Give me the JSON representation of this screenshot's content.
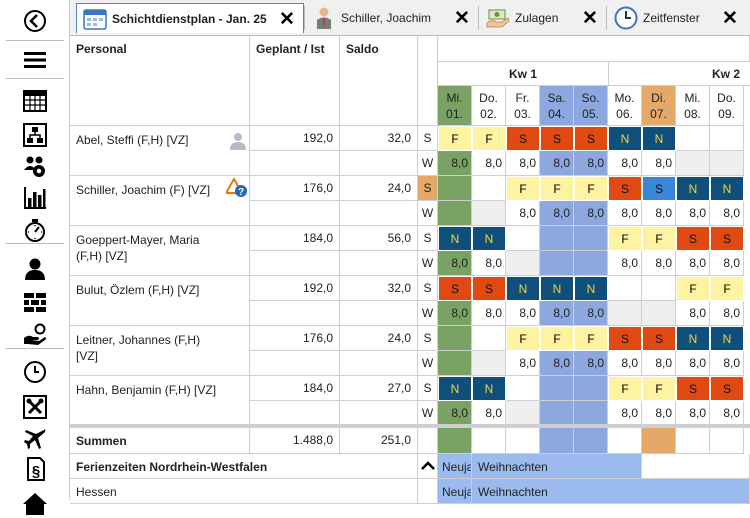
{
  "sidebar": {
    "items": [
      "back-icon",
      "menu-icon",
      "calendar-grid-icon",
      "org-chart-icon",
      "group-view-icon",
      "statistics-icon",
      "stopwatch-icon",
      "person-icon",
      "bricks-icon",
      "hand-coins-icon",
      "clock-icon",
      "tools-icon",
      "airplane-icon",
      "paragraph-icon",
      "home-icon"
    ]
  },
  "tabs": [
    {
      "label": "Schichtdienstplan - Jan. 25",
      "icon": "calendar-icon",
      "active": true
    },
    {
      "label": "Schiller, Joachim",
      "icon": "person-icon",
      "active": false
    },
    {
      "label": "Zulagen",
      "icon": "money-hand-icon",
      "active": false
    },
    {
      "label": "Zeitfenster",
      "icon": "clock-icon",
      "active": false
    }
  ],
  "table": {
    "col_personal": "Personal",
    "col_geplant": "Geplant / Ist",
    "col_saldo": "Saldo",
    "weeks": [
      {
        "label": "Kw 1"
      },
      {
        "label": "Kw 2"
      }
    ],
    "days": [
      {
        "name": "Mi.",
        "date": "01.",
        "type": "holiday"
      },
      {
        "name": "Do.",
        "date": "02.",
        "type": "normal"
      },
      {
        "name": "Fr.",
        "date": "03.",
        "type": "normal"
      },
      {
        "name": "Sa.",
        "date": "04.",
        "type": "weekend"
      },
      {
        "name": "So.",
        "date": "05.",
        "type": "weekend"
      },
      {
        "name": "Mo.",
        "date": "06.",
        "type": "normal"
      },
      {
        "name": "Di.",
        "date": "07.",
        "type": "today"
      },
      {
        "name": "Mi.",
        "date": "08.",
        "type": "normal"
      },
      {
        "name": "Do.",
        "date": "09.",
        "type": "normal"
      }
    ],
    "row_label_s": "S",
    "row_label_w": "W",
    "employees": [
      {
        "name": "Abel, Steffi (F,H) [VZ]",
        "geplant": "192,0",
        "saldo": "32,0",
        "icon": "person-grey-icon",
        "shifts": [
          "F",
          "F",
          "S",
          "S",
          "S",
          "N",
          "N",
          "",
          ""
        ],
        "hours": [
          "8,0",
          "8,0",
          "8,0",
          "8,0",
          "8,0",
          "8,0",
          "8,0",
          "",
          ""
        ]
      },
      {
        "name": "Schiller, Joachim (F) [VZ]",
        "geplant": "176,0",
        "saldo": "24,0",
        "icon": "warning-question-icon",
        "s_highlight": true,
        "shifts": [
          "",
          "",
          "F",
          "F",
          "F",
          "S",
          "S",
          "N",
          "N"
        ],
        "hours": [
          "",
          "",
          "8,0",
          "8,0",
          "8,0",
          "8,0",
          "8,0",
          "8,0",
          "8,0"
        ]
      },
      {
        "name": "Goeppert-Mayer, Maria (F,H) [VZ]",
        "geplant": "184,0",
        "saldo": "56,0",
        "icon": "",
        "shifts": [
          "N",
          "N",
          "",
          "",
          "",
          "F",
          "F",
          "S",
          "S"
        ],
        "hours": [
          "8,0",
          "8,0",
          "",
          "",
          "",
          "8,0",
          "8,0",
          "8,0",
          "8,0"
        ]
      },
      {
        "name": "Bulut, Özlem (F,H) [VZ]",
        "geplant": "192,0",
        "saldo": "32,0",
        "icon": "",
        "shifts": [
          "S",
          "S",
          "N",
          "N",
          "N",
          "",
          "",
          "F",
          "F"
        ],
        "hours": [
          "8,0",
          "8,0",
          "8,0",
          "8,0",
          "8,0",
          "",
          "",
          "8,0",
          "8,0"
        ]
      },
      {
        "name": "Leitner, Johannes (F,H) [VZ]",
        "geplant": "176,0",
        "saldo": "24,0",
        "icon": "",
        "shifts": [
          "",
          "",
          "F",
          "F",
          "F",
          "S",
          "S",
          "N",
          "N"
        ],
        "hours": [
          "",
          "",
          "8,0",
          "8,0",
          "8,0",
          "8,0",
          "8,0",
          "8,0",
          "8,0"
        ]
      },
      {
        "name": "Hahn, Benjamin (F,H) [VZ]",
        "geplant": "184,0",
        "saldo": "27,0",
        "icon": "",
        "shifts": [
          "N",
          "N",
          "",
          "",
          "",
          "F",
          "F",
          "S",
          "S"
        ],
        "hours": [
          "8,0",
          "8,0",
          "",
          "",
          "",
          "8,0",
          "8,0",
          "8,0",
          "8,0"
        ]
      }
    ],
    "summen_label": "Summen",
    "summen_geplant": "1.488,0",
    "summen_saldo": "251,0",
    "ferien_label": "Ferienzeiten Nordrhein-Westfalen",
    "hessen_label": "Hessen",
    "ferien_short": "Neuja",
    "ferien_name": "Weihnachten"
  },
  "colors": {
    "F": "#fdf3a0",
    "S": "#e04a12",
    "N": "#0e4f7c",
    "S_today": "#3a86d8",
    "holiday": "#7aa264",
    "today": "#e3a86a",
    "weekend": "#8ca8df",
    "ferien": "#9bbbef",
    "empty": "#efefef"
  }
}
